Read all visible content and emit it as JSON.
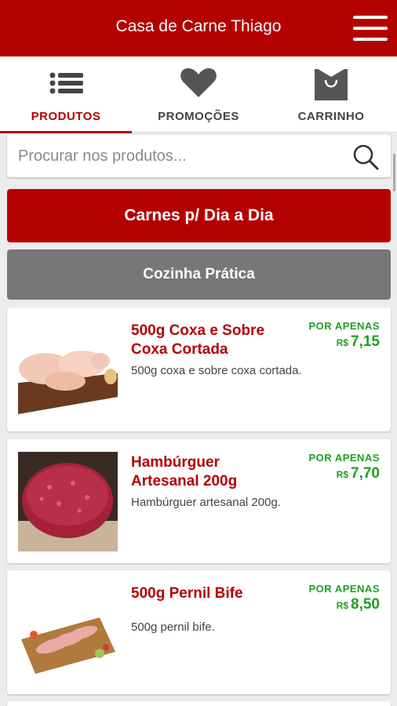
{
  "header": {
    "title": "Casa de Carne Thiago",
    "menu_icon": "hamburger-menu-icon"
  },
  "tabs": [
    {
      "label": "PRODUTOS",
      "icon": "list-icon",
      "active": true
    },
    {
      "label": "PROMOÇÕES",
      "icon": "heart-icon",
      "active": false
    },
    {
      "label": "CARRINHO",
      "icon": "shopping-bag-icon",
      "active": false
    }
  ],
  "search": {
    "placeholder": "Procurar nos produtos...",
    "value": "",
    "icon": "search-icon"
  },
  "categories": [
    {
      "label": "Carnes p/ Dia a Dia",
      "color": "#b50000"
    },
    {
      "label": "Cozinha Prática",
      "color": "#777777"
    }
  ],
  "products": [
    {
      "name": "500g Coxa e Sobre Coxa Cortada",
      "description": "500g coxa e sobre coxa cortada.",
      "price_prefix": "POR APENAS",
      "currency": "R$",
      "price": "7,15"
    },
    {
      "name": "Hambúrguer Artesanal 200g",
      "description": "Hambúrguer artesanal 200g.",
      "price_prefix": "POR APENAS",
      "currency": "R$",
      "price": "7,70"
    },
    {
      "name": "500g Pernil Bife",
      "description": "500g pernil bife.",
      "price_prefix": "POR APENAS",
      "currency": "R$",
      "price": "8,50"
    }
  ],
  "colors": {
    "brand": "#b50000",
    "price": "#1ea01e",
    "secondary": "#777777"
  }
}
